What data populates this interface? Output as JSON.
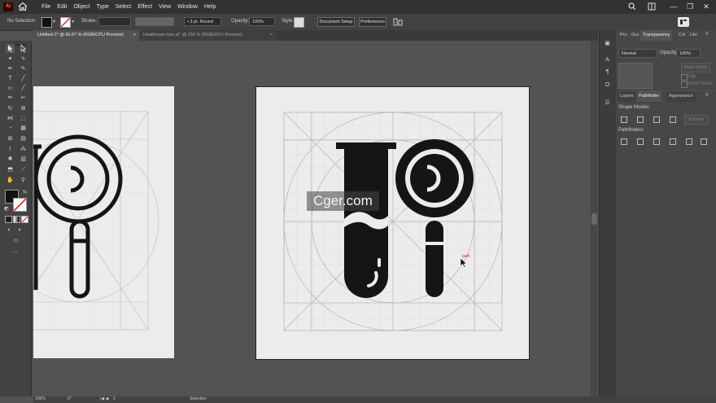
{
  "app": {
    "logo": "Ai"
  },
  "menu": [
    "File",
    "Edit",
    "Object",
    "Type",
    "Select",
    "Effect",
    "View",
    "Window",
    "Help"
  ],
  "window_controls": {
    "minimize": "—",
    "restore": "❐",
    "close": "✕"
  },
  "control_bar": {
    "selection_label": "No Selection",
    "stroke_label": "Stroke:",
    "stroke_profile": "3 pt. Round",
    "opacity_label": "Opacity:",
    "opacity_value": "100%",
    "style_label": "Style:",
    "document_setup": "Document Setup",
    "preferences": "Preferences"
  },
  "tabs": [
    {
      "label": "Untitled-1* @ 66.67 % (RGB/CPU Preview)",
      "close": "×",
      "active": true
    },
    {
      "label": "Healthcare icon.ai* @ 150 % (RGB/CPU Preview)",
      "close": "×",
      "active": false
    }
  ],
  "panel_top": {
    "tabs": [
      "Pro",
      "Gra",
      "Transparency",
      "Col",
      "Libr"
    ],
    "blend_mode": "Normal",
    "opacity_label": "Opacity:",
    "opacity_value": "100%",
    "make_mask": "Make Mask",
    "clip": "Clip",
    "invert_mask": "Invert Mask"
  },
  "panel_bottom": {
    "tabs": [
      "Layers",
      "Pathfinder",
      "Appearance"
    ],
    "shape_modes": "Shape Modes:",
    "expand": "Expand",
    "pathfinders": "Pathfinders:"
  },
  "canvas": {
    "cursor_label": "path",
    "watermark": "Cger.com"
  },
  "status": {
    "zoom": "100%",
    "angle": "0°",
    "artboard_num": "2",
    "tool": "Selection"
  },
  "colors": {
    "icon_fill": "#151515",
    "guide": "#b9b9b9",
    "artboard": "#ececec",
    "active_tool": "#5a5a5a",
    "cursor_label": "#e0185a"
  }
}
